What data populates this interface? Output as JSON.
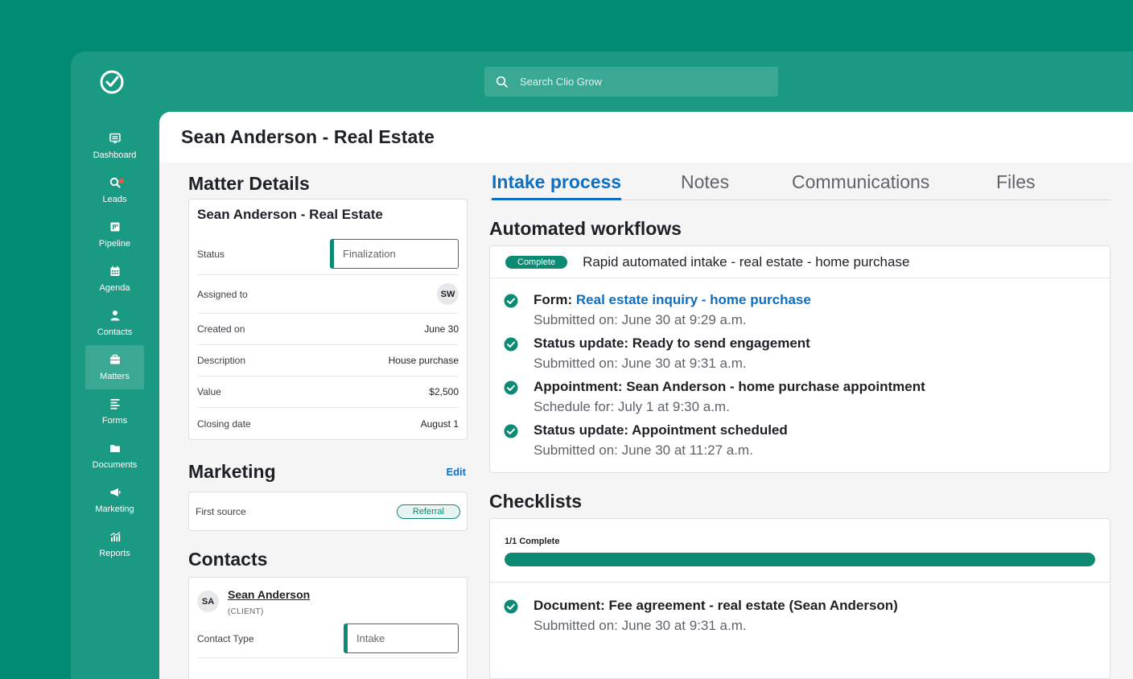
{
  "search": {
    "placeholder": "Search Clio Grow"
  },
  "nav": {
    "items": [
      {
        "label": "Dashboard",
        "icon": "dashboard-icon"
      },
      {
        "label": "Leads",
        "icon": "leads-icon"
      },
      {
        "label": "Pipeline",
        "icon": "pipeline-icon"
      },
      {
        "label": "Agenda",
        "icon": "calendar-icon"
      },
      {
        "label": "Contacts",
        "icon": "person-icon"
      },
      {
        "label": "Matters",
        "icon": "briefcase-icon",
        "active": true
      },
      {
        "label": "Forms",
        "icon": "forms-icon"
      },
      {
        "label": "Documents",
        "icon": "folder-icon"
      },
      {
        "label": "Marketing",
        "icon": "megaphone-icon"
      },
      {
        "label": "Reports",
        "icon": "reports-icon"
      }
    ]
  },
  "page": {
    "title": "Sean Anderson - Real Estate"
  },
  "matter_details": {
    "heading": "Matter Details",
    "card_title": "Sean Anderson - Real Estate",
    "status_label": "Status",
    "status_value": "Finalization",
    "assigned_label": "Assigned to",
    "assigned_initials": "SW",
    "created_label": "Created on",
    "created_value": "June 30",
    "description_label": "Description",
    "description_value": "House purchase",
    "value_label": "Value",
    "value_value": "$2,500",
    "closing_label": "Closing date",
    "closing_value": "August 1"
  },
  "marketing": {
    "heading": "Marketing",
    "edit_label": "Edit",
    "first_source_label": "First source",
    "first_source_value": "Referral"
  },
  "contacts": {
    "heading": "Contacts",
    "initials": "SA",
    "name": "Sean Anderson",
    "role": "(CLIENT)",
    "type_label": "Contact Type",
    "type_value": "Intake"
  },
  "tabs": [
    {
      "label": "Intake process",
      "active": true
    },
    {
      "label": "Notes"
    },
    {
      "label": "Communications"
    },
    {
      "label": "Files"
    }
  ],
  "workflows": {
    "heading": "Automated workflows",
    "badge": "Complete",
    "name": "Rapid automated intake - real estate - home purchase",
    "steps": [
      {
        "title": "Form: ",
        "link": "Real estate inquiry - home purchase",
        "sub": "Submitted on: June 30 at 9:29 a.m."
      },
      {
        "title": "Status update: Ready to send engagement",
        "link": "",
        "sub": "Submitted on: June 30 at 9:31  a.m."
      },
      {
        "title": "Appointment: Sean Anderson - home purchase appointment",
        "link": "",
        "sub": "Schedule for: July 1 at 9:30  a.m."
      },
      {
        "title": "Status update: Appointment scheduled",
        "link": "",
        "sub": "Submitted on: June 30 at 11:27  a.m."
      }
    ]
  },
  "checklists": {
    "heading": "Checklists",
    "count": "1/1 Complete",
    "progress": 1.0,
    "items": [
      {
        "title": "Document: Fee agreement - real estate (Sean Anderson)",
        "sub": "Submitted on: June 30 at 9:31 a.m."
      }
    ]
  },
  "colors": {
    "brand": "#018a74",
    "accent_blue": "#0e6fc1",
    "complete": "#0c8a73"
  }
}
